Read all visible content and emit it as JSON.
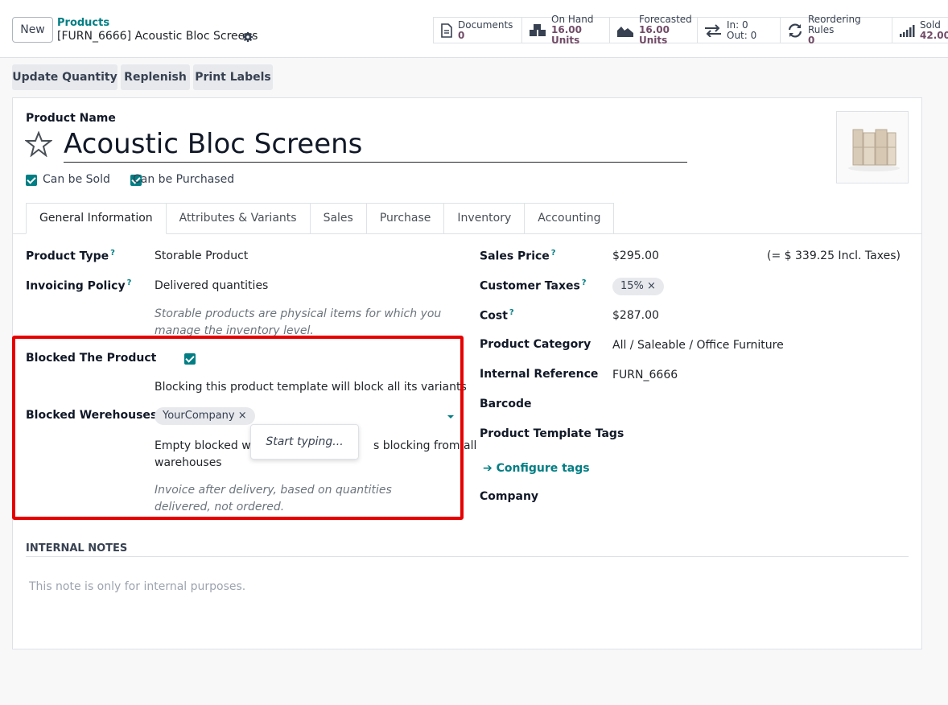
{
  "header": {
    "new_label": "New",
    "breadcrumb_parent": "Products",
    "breadcrumb_current": "[FURN_6666] Acoustic Bloc Screens",
    "stats": [
      {
        "label": "Documents",
        "value": "0",
        "icon": "document-icon"
      },
      {
        "label": "On Hand",
        "value": "16.00 Units",
        "icon": "cubes-icon"
      },
      {
        "label": "Forecasted",
        "value": "16.00 Units",
        "icon": "area-chart-icon"
      },
      {
        "label": "In: 0",
        "value": "Out: 0",
        "icon": "exchange-arrows-icon"
      },
      {
        "label": "Reordering Rules",
        "value": "0",
        "icon": "refresh-icon"
      },
      {
        "label": "Sold",
        "value": "42.00",
        "icon": "signal-bars-icon"
      }
    ]
  },
  "actions": {
    "update_quantity": "Update Quantity",
    "replenish": "Replenish",
    "print_labels": "Print Labels"
  },
  "product": {
    "name_label": "Product Name",
    "name": "Acoustic Bloc Screens",
    "can_be_sold": "Can be Sold",
    "can_be_purchased": "Can be Purchased"
  },
  "tabs": [
    "General Information",
    "Attributes & Variants",
    "Sales",
    "Purchase",
    "Inventory",
    "Accounting"
  ],
  "left": {
    "product_type_label": "Product Type",
    "product_type": "Storable Product",
    "invoicing_policy_label": "Invoicing Policy",
    "invoicing_policy": "Delivered quantities",
    "storable_note": "Storable products are physical items for which you manage the inventory level.",
    "blocked_product_label": "Blocked The Product",
    "blocking_note": "Blocking this product template will block all its variants",
    "blocked_warehouses_label": "Blocked Werehouses",
    "warehouse_tag": "YourCompany",
    "empty_note_a": "Empty blocked war",
    "empty_note_b": "s blocking from all",
    "empty_note_c": "warehouses",
    "dropdown_text": "Start typing...",
    "invoice_note": "Invoice after delivery, based on quantities delivered, not ordered."
  },
  "right": {
    "sales_price_label": "Sales Price",
    "sales_price": "$295.00",
    "incl_taxes": "(= $ 339.25 Incl. Taxes)",
    "customer_taxes_label": "Customer Taxes",
    "tax_tag": "15%",
    "cost_label": "Cost",
    "cost": "$287.00",
    "category_label": "Product Category",
    "category": "All / Saleable / Office Furniture",
    "internal_ref_label": "Internal Reference",
    "internal_ref": "FURN_6666",
    "barcode_label": "Barcode",
    "template_tags_label": "Product Template Tags",
    "configure_tags": "Configure tags",
    "company_label": "Company"
  },
  "notes": {
    "heading": "INTERNAL NOTES",
    "placeholder": "This note is only for internal purposes."
  },
  "colors": {
    "accent": "#017e84",
    "brand": "#714b67",
    "highlight": "#e60000"
  }
}
